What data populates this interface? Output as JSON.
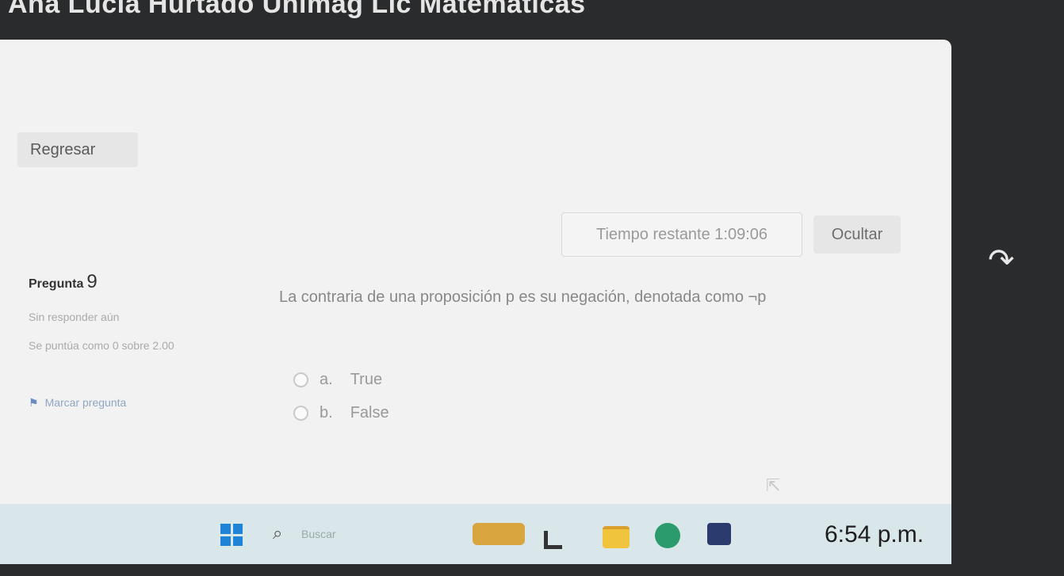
{
  "app": {
    "title": "Ana Lucía Hurtado Unimag Lic Matemáticas"
  },
  "nav": {
    "back_label": "Regresar"
  },
  "timer": {
    "label": "Tiempo restante 1:09:06",
    "hide_label": "Ocultar"
  },
  "question": {
    "label": "Pregunta",
    "number": "9",
    "state": "Sin responder aún",
    "grade": "Se puntúa como 0 sobre 2.00",
    "flag_label": "Marcar pregunta",
    "text": "La contraria de una proposición p es su negación, denotada como ¬p",
    "options": [
      {
        "letter": "a.",
        "label": "True"
      },
      {
        "letter": "b.",
        "label": "False"
      }
    ]
  },
  "taskbar": {
    "search_placeholder": "Buscar",
    "time": "6:54 p.m."
  },
  "icons": {
    "flag": "flag-icon",
    "search": "search-icon",
    "windows": "windows-start-icon",
    "side_arrow": "forward-arrow-icon"
  }
}
